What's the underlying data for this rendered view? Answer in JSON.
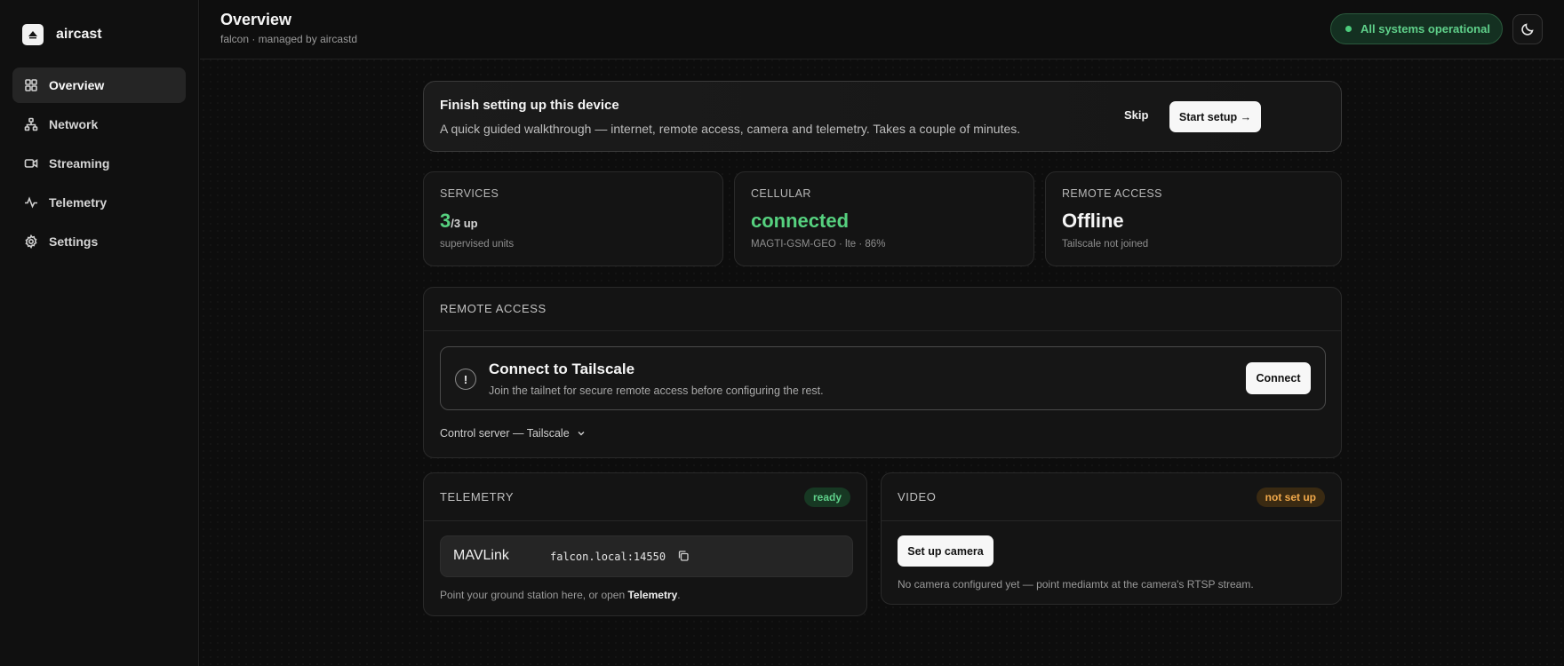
{
  "app": {
    "name": "aircast"
  },
  "sidebar": {
    "items": [
      {
        "label": "Overview",
        "icon": "grid-icon",
        "active": true
      },
      {
        "label": "Network",
        "icon": "network-icon",
        "active": false
      },
      {
        "label": "Streaming",
        "icon": "video-icon",
        "active": false
      },
      {
        "label": "Telemetry",
        "icon": "activity-icon",
        "active": false
      },
      {
        "label": "Settings",
        "icon": "gear-icon",
        "active": false
      }
    ]
  },
  "header": {
    "title": "Overview",
    "subtitle": "falcon · managed by aircastd",
    "status": "All systems operational",
    "status_color": "#4ccc7c",
    "theme_icon": "moon-icon"
  },
  "setup": {
    "title": "Finish setting up this device",
    "description": "A quick guided walkthrough — internet, remote access, camera and telemetry. Takes a couple of minutes.",
    "skip": "Skip",
    "start": "Start setup →"
  },
  "stats": {
    "services": {
      "label": "SERVICES",
      "value": "3",
      "suffix": "/3 up",
      "sub": "supervised units",
      "color": "#56d17f"
    },
    "cellular": {
      "label": "CELLULAR",
      "value": "connected",
      "sub": "MAGTI-GSM-GEO · lte · 86%",
      "color": "#56d17f"
    },
    "remote": {
      "label": "REMOTE ACCESS",
      "value": "Offline",
      "sub": "Tailscale not joined",
      "color": "#f5f5f5"
    }
  },
  "remote_access": {
    "label": "REMOTE ACCESS",
    "alert_title": "Connect to Tailscale",
    "alert_desc": "Join the tailnet for secure remote access before configuring the rest.",
    "alert_icon": "!",
    "connect": "Connect",
    "control_server": "Control server — Tailscale"
  },
  "telemetry": {
    "label": "TELEMETRY",
    "badge": "ready",
    "protocol": "MAVLink",
    "endpoint": "falcon.local:14550",
    "hint_prefix": "Point your ground station here, or open ",
    "hint_link": "Telemetry",
    "hint_suffix": "."
  },
  "video": {
    "label": "VIDEO",
    "badge": "not set up",
    "button": "Set up camera",
    "hint": "No camera configured yet — point mediamtx at the camera's RTSP stream."
  }
}
